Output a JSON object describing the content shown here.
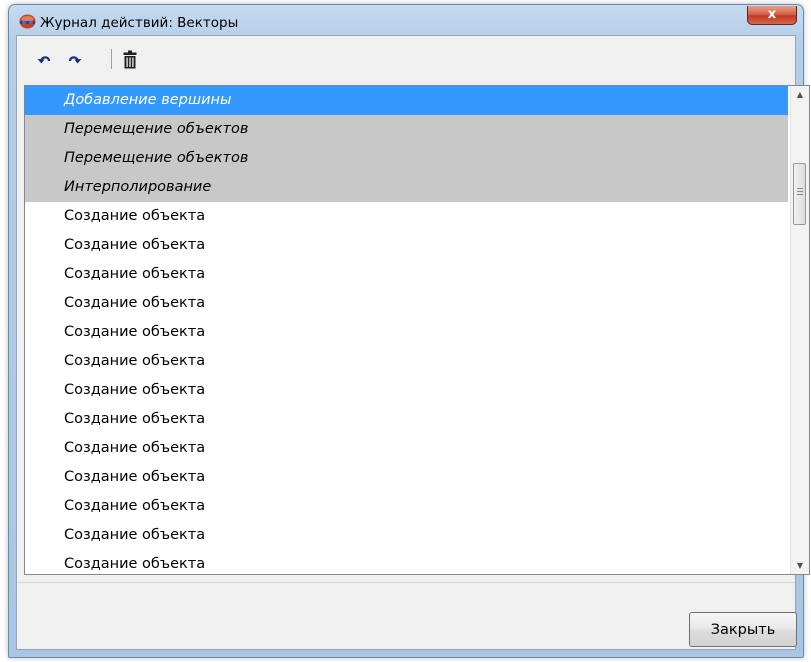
{
  "window": {
    "title": "Журнал действий: Векторы",
    "close_glyph": "x"
  },
  "toolbar": {
    "undo_icon": "undo-icon",
    "redo_icon": "redo-icon",
    "delete_icon": "trash-icon"
  },
  "list": {
    "rows": [
      {
        "label": "Добавление вершины",
        "state": "selected"
      },
      {
        "label": "Перемещение объектов",
        "state": "undone"
      },
      {
        "label": "Перемещение объектов",
        "state": "undone"
      },
      {
        "label": "Интерполирование",
        "state": "undone"
      },
      {
        "label": "Создание объекта",
        "state": "normal"
      },
      {
        "label": "Создание объекта",
        "state": "normal"
      },
      {
        "label": "Создание объекта",
        "state": "normal"
      },
      {
        "label": "Создание объекта",
        "state": "normal"
      },
      {
        "label": "Создание объекта",
        "state": "normal"
      },
      {
        "label": "Создание объекта",
        "state": "normal"
      },
      {
        "label": "Создание объекта",
        "state": "normal"
      },
      {
        "label": "Создание объекта",
        "state": "normal"
      },
      {
        "label": "Создание объекта",
        "state": "normal"
      },
      {
        "label": "Создание объекта",
        "state": "normal"
      },
      {
        "label": "Создание объекта",
        "state": "normal"
      },
      {
        "label": "Создание объекта",
        "state": "normal"
      },
      {
        "label": "Создание объекта",
        "state": "normal"
      }
    ]
  },
  "footer": {
    "close_label": "Закрыть"
  },
  "colors": {
    "selection": "#3399ff",
    "undone": "#c8c8c8"
  }
}
